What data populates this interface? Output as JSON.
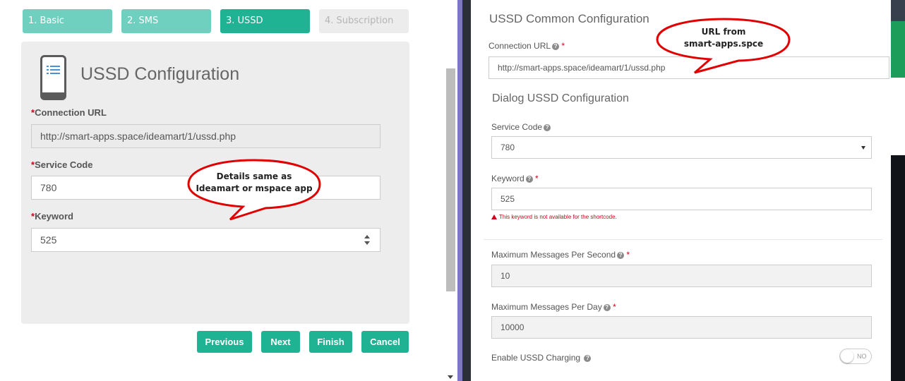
{
  "left": {
    "steps": [
      {
        "label": "1. Basic",
        "state": "done"
      },
      {
        "label": "2. SMS",
        "state": "done"
      },
      {
        "label": "3. USSD",
        "state": "active"
      },
      {
        "label": "4. Subscription",
        "state": "todo"
      }
    ],
    "card_title": "USSD Configuration",
    "fields": {
      "connection_url": {
        "label": "Connection URL",
        "value": "http://smart-apps.space/ideamart/1/ussd.php"
      },
      "service_code": {
        "label": "Service Code",
        "value": "780"
      },
      "keyword": {
        "label": "Keyword",
        "value": "525"
      }
    },
    "required_mark": "*",
    "buttons": {
      "previous": "Previous",
      "next": "Next",
      "finish": "Finish",
      "cancel": "Cancel"
    }
  },
  "modal": {
    "title": "USSD Common Configuration",
    "connection_url_label": "Connection URL",
    "connection_url_value": "http://smart-apps.space/ideamart/1/ussd.php",
    "dialog_title": "Dialog USSD Configuration",
    "service_code_label": "Service Code",
    "service_code_value": "780",
    "keyword_label": "Keyword",
    "keyword_value": "525",
    "keyword_error": "This keyword is not available for the shortcode.",
    "max_per_second_label": "Maximum Messages Per Second",
    "max_per_second_value": "10",
    "max_per_day_label": "Maximum Messages Per Day",
    "max_per_day_value": "10000",
    "charging_label": "Enable USSD Charging",
    "charging_toggle": "NO",
    "required_mark": "*",
    "help_glyph": "?"
  },
  "callouts": {
    "left": {
      "line1": "Details same as",
      "line2": "Ideamart or mspace app"
    },
    "right": {
      "line1": "URL from",
      "line2": "smart-apps.spce"
    }
  },
  "colors": {
    "accent": "#1fb293",
    "accent_light": "#6fd0bf",
    "required": "#d0021b",
    "callout_border": "#e00000"
  },
  "icons": {
    "phone": "mobile-list-icon",
    "help": "help-circle-icon",
    "warning": "warning-triangle-icon"
  }
}
